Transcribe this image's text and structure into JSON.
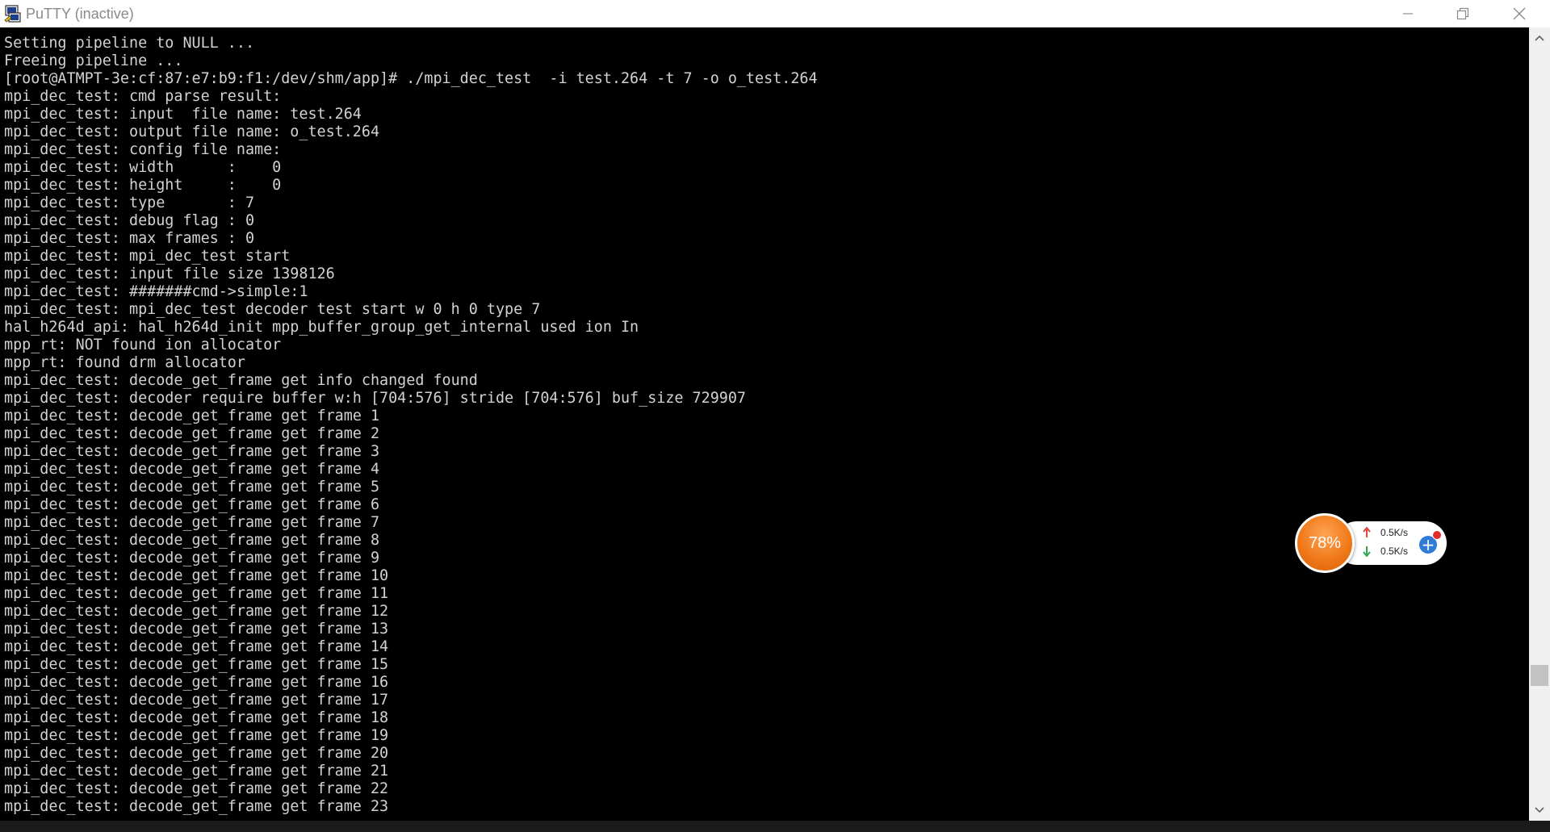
{
  "window": {
    "title": "PuTTY (inactive)",
    "minimize_icon": "minimize-icon",
    "maximize_icon": "restore-icon",
    "close_icon": "close-icon"
  },
  "terminal": {
    "background": "#000000",
    "foreground": "#d2d2d2",
    "lines": [
      "Setting pipeline to NULL ...",
      "Freeing pipeline ...",
      "[root@ATMPT-3e:cf:87:e7:b9:f1:/dev/shm/app]# ./mpi_dec_test  -i test.264 -t 7 -o o_test.264",
      "mpi_dec_test: cmd parse result:",
      "mpi_dec_test: input  file name: test.264",
      "mpi_dec_test: output file name: o_test.264",
      "mpi_dec_test: config file name:",
      "mpi_dec_test: width      :    0",
      "mpi_dec_test: height     :    0",
      "mpi_dec_test: type       : 7",
      "mpi_dec_test: debug flag : 0",
      "mpi_dec_test: max frames : 0",
      "mpi_dec_test: mpi_dec_test start",
      "mpi_dec_test: input file size 1398126",
      "mpi_dec_test: #######cmd->simple:1",
      "mpi_dec_test: mpi_dec_test decoder test start w 0 h 0 type 7",
      "hal_h264d_api: hal_h264d_init mpp_buffer_group_get_internal used ion In",
      "mpp_rt: NOT found ion allocator",
      "mpp_rt: found drm allocator",
      "mpi_dec_test: decode_get_frame get info changed found",
      "mpi_dec_test: decoder require buffer w:h [704:576] stride [704:576] buf_size 729907",
      "mpi_dec_test: decode_get_frame get frame 1",
      "mpi_dec_test: decode_get_frame get frame 2",
      "mpi_dec_test: decode_get_frame get frame 3",
      "mpi_dec_test: decode_get_frame get frame 4",
      "mpi_dec_test: decode_get_frame get frame 5",
      "mpi_dec_test: decode_get_frame get frame 6",
      "mpi_dec_test: decode_get_frame get frame 7",
      "mpi_dec_test: decode_get_frame get frame 8",
      "mpi_dec_test: decode_get_frame get frame 9",
      "mpi_dec_test: decode_get_frame get frame 10",
      "mpi_dec_test: decode_get_frame get frame 11",
      "mpi_dec_test: decode_get_frame get frame 12",
      "mpi_dec_test: decode_get_frame get frame 13",
      "mpi_dec_test: decode_get_frame get frame 14",
      "mpi_dec_test: decode_get_frame get frame 15",
      "mpi_dec_test: decode_get_frame get frame 16",
      "mpi_dec_test: decode_get_frame get frame 17",
      "mpi_dec_test: decode_get_frame get frame 18",
      "mpi_dec_test: decode_get_frame get frame 19",
      "mpi_dec_test: decode_get_frame get frame 20",
      "mpi_dec_test: decode_get_frame get frame 21",
      "mpi_dec_test: decode_get_frame get frame 22",
      "mpi_dec_test: decode_get_frame get frame 23"
    ]
  },
  "scrollbar": {
    "up_icon": "chevron-up-icon",
    "down_icon": "chevron-down-icon"
  },
  "network_widget": {
    "usage_percent": "78%",
    "upload_rate": "0.5K/s",
    "download_rate": "0.5K/s",
    "upload_icon": "arrow-up-icon",
    "download_icon": "arrow-down-icon",
    "plus_icon": "plus-icon",
    "accent": "#f07a1a",
    "upload_color": "#e0463a",
    "download_color": "#2fa84a"
  }
}
